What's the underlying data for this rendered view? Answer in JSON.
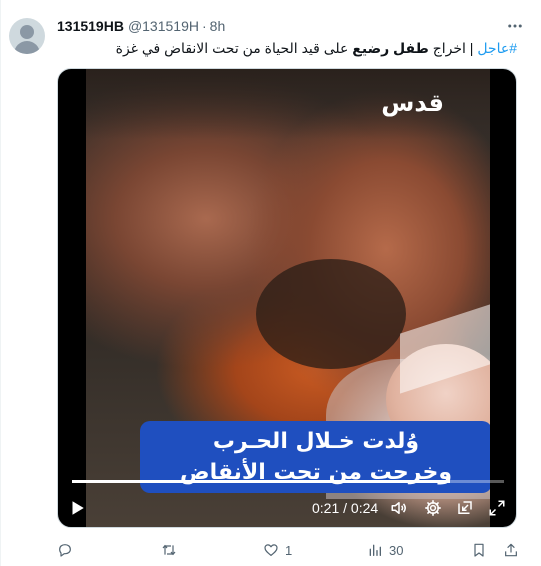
{
  "tweet": {
    "display_name": "131519HB",
    "handle": "@131519H",
    "separator": "·",
    "time": "8h",
    "text": {
      "hashtag": "#عاجل",
      "part1": " | اخراج ",
      "bold": "طفل رضيع",
      "part2": " على قيد الحياة من تحت الانقاض في غزة"
    }
  },
  "video": {
    "logo_text": "قدس",
    "caption_line1": "وُلدت خـلال الحـرب",
    "caption_line2": "وخرجت من تحت الأنقاض",
    "timecode": "0:21 / 0:24",
    "progress_fraction": 0.875
  },
  "actions": {
    "reply_count": "",
    "retweet_count": "",
    "like_count": "1",
    "views_count": "30"
  },
  "colors": {
    "accent": "#1d9bf0",
    "caption_bg": "#1f4fbf",
    "muted": "#536471"
  }
}
